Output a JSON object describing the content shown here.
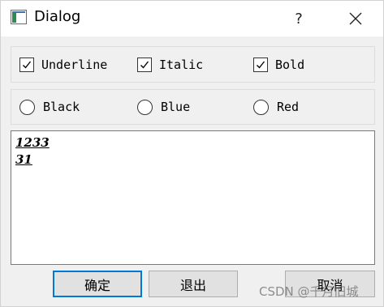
{
  "window": {
    "title": "Dialog",
    "help_label": "?"
  },
  "checkboxes": [
    {
      "label": "Underline",
      "checked": true
    },
    {
      "label": "Italic",
      "checked": true
    },
    {
      "label": "Bold",
      "checked": true
    }
  ],
  "radios": [
    {
      "label": "Black",
      "selected": false
    },
    {
      "label": "Blue",
      "selected": false
    },
    {
      "label": "Red",
      "selected": false
    }
  ],
  "editor": {
    "lines": [
      "1233",
      "31"
    ]
  },
  "buttons": {
    "ok_label": "确定",
    "exit_label": "退出",
    "cancel_label": "取消"
  },
  "watermark": "CSDN @千月旧城",
  "colors": {
    "focus_border": "#0078d7",
    "button_bg": "#e1e1e1",
    "window_bg": "#f0f0f0"
  },
  "icons": {
    "app": "app-icon",
    "close": "close-icon",
    "check": "check-icon"
  }
}
